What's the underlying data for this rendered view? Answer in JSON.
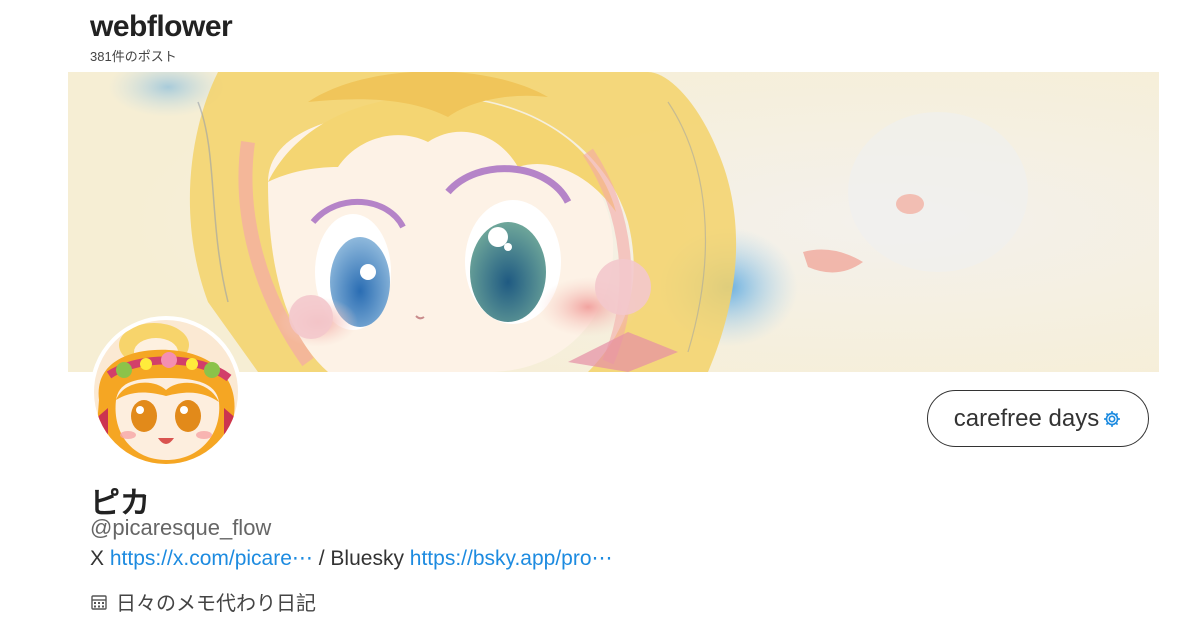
{
  "header": {
    "title": "webflower",
    "post_count": "381件のポスト"
  },
  "profile": {
    "display_name": "ピカ",
    "handle": "@picaresque_flow",
    "follow_label": "carefree days",
    "bio": {
      "x_prefix": "X ",
      "x_link": "https://x.com/picare⋯",
      "separator": " / Bluesky ",
      "bluesky_link": "https://bsky.app/pro⋯"
    },
    "description": "日々のメモ代わり日記"
  },
  "icons": {
    "follow_icon": "gear-icon",
    "description_icon": "calendar-icon"
  },
  "colors": {
    "link": "#1d8be0",
    "gear": "#1d8be0"
  }
}
